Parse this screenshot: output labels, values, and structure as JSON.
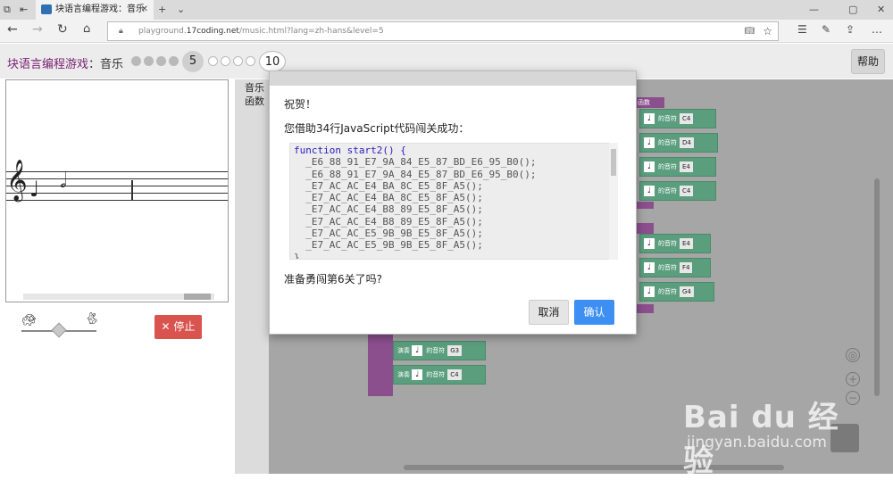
{
  "browser": {
    "tab_title": "块语言编程游戏：音乐",
    "url_prefix": "playground.",
    "url_host": "17coding.net",
    "url_path": "/music.html?lang=zh-hans&level=5"
  },
  "app": {
    "title": "块语言编程游戏",
    "subtitle": "：音乐",
    "current_level": "5",
    "max_level": "10",
    "help_label": "帮助",
    "stop_label": "停止"
  },
  "toolbox": {
    "categories": [
      "音乐",
      "函数"
    ]
  },
  "workspace": {
    "func_label": "函数",
    "play_label": "演奏",
    "note_of_label": "的音符",
    "note_glyph": "♩",
    "group1": [
      "C4",
      "D4",
      "E4",
      "C4"
    ],
    "group2": [
      "E4",
      "F4",
      "G4"
    ],
    "group3": [
      "G3",
      "C4"
    ]
  },
  "dialog": {
    "title": "祝贺！",
    "message": "您借助34行JavaScript代码闯关成功：",
    "code_lines": [
      "function start2() {",
      "  _E6_88_91_E7_9A_84_E5_87_BD_E6_95_B0();",
      "  _E6_88_91_E7_9A_84_E5_87_BD_E6_95_B0();",
      "  _E7_AC_AC_E4_BA_8C_E5_8F_A5();",
      "  _E7_AC_AC_E4_BA_8C_E5_8F_A5();",
      "  _E7_AC_AC_E4_B8_89_E5_8F_A5();",
      "  _E7_AC_AC_E4_B8_89_E5_8F_A5();",
      "  _E7_AC_AC_E5_9B_9B_E5_8F_A5();",
      "  _E7_AC_AC_E5_9B_9B_E5_8F_A5();",
      "}"
    ],
    "question": "准备勇闯第6关了吗?",
    "cancel_label": "取消",
    "confirm_label": "确认"
  },
  "watermark": {
    "brand": "Bai du 经验",
    "url": "jingyan.baidu.com"
  },
  "colors": {
    "title_purple": "#7a1f72",
    "block_green": "#5b9e7e",
    "func_purple": "#8b4f8d",
    "stop_red": "#d9534f",
    "confirm_blue": "#3d8ff4"
  }
}
